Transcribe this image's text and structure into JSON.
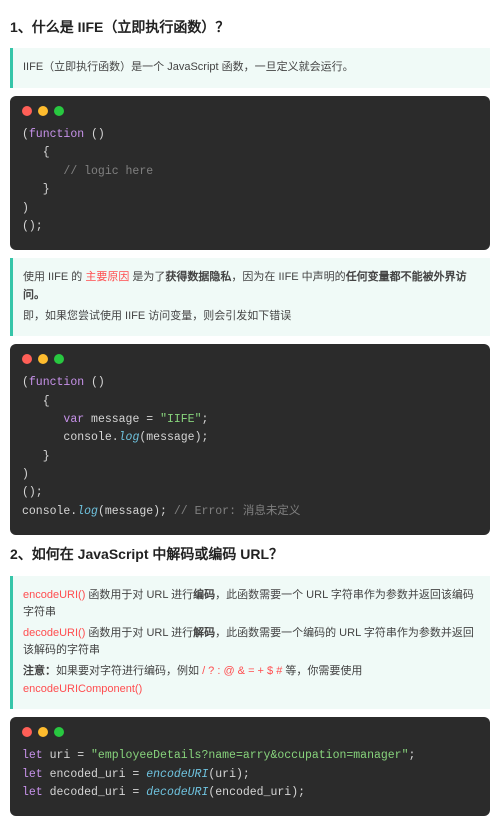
{
  "section1": {
    "title": "1、什么是 IIFE（立即执行函数）？",
    "intro": "IIFE（立即执行函数）是一个 JavaScript 函数，一旦定义就会运行。",
    "code1": {
      "l1_k": "function",
      "l1_p": " ()",
      "l2": "{",
      "l3_cm": "// logic here",
      "l4": "}",
      "l5": ")",
      "l6": "();"
    },
    "note2": {
      "p1a": "使用 IIFE 的 ",
      "p1b": "主要原因",
      "p1c": " 是为了",
      "p1d": "获得数据隐私",
      "p1e": "，因为在 IIFE 中声明的",
      "p1f": "任何变量都不能被外界访问。",
      "p2": "即，如果您尝试使用 IIFE 访问变量，则会引发如下错误"
    },
    "code2": {
      "l1_k": "function",
      "l1_p": " ()",
      "l2": "{",
      "l3_k": "var",
      "l3_v": " message = ",
      "l3_s": "\"IIFE\"",
      "l3_e": ";",
      "l4a": "console.",
      "l4b": "log",
      "l4c": "(message);",
      "l5": "}",
      "l6": ")",
      "l7": "();",
      "l8a": "console.",
      "l8b": "log",
      "l8c": "(message); ",
      "l8cm": "// Error: 消息未定义"
    }
  },
  "section2": {
    "title": "2、如何在 JavaScript 中解码或编码 URL？",
    "note": {
      "p1a": "encodeURI()",
      "p1b": " 函数用于对 URL 进行",
      "p1c": "编码",
      "p1d": "，此函数需要一个 URL 字符串作为参数并返回该编码字符串",
      "p2a": "decodeURI()",
      "p2b": " 函数用于对 URL 进行",
      "p2c": "解码",
      "p2d": "，此函数需要一个编码的 URL 字符串作为参数并返回该解码的字符串",
      "p3a": "注意：",
      "p3b": "如果要对字符进行编码，例如 ",
      "p3c": "/ ? : @ & = + $ #",
      "p3d": " 等，你需要使用 ",
      "p3e": "encodeURIComponent()"
    },
    "code": {
      "l1_k": "let",
      "l1_v": " uri = ",
      "l1_s": "\"employeeDetails?name=arry&occupation=manager\"",
      "l1_e": ";",
      "l2_k": "let",
      "l2_v": " encoded_uri = ",
      "l2_f": "encodeURI",
      "l2_e": "(uri);",
      "l3_k": "let",
      "l3_v": " decoded_uri = ",
      "l3_f": "decodeURI",
      "l3_e": "(encoded_uri);"
    }
  }
}
